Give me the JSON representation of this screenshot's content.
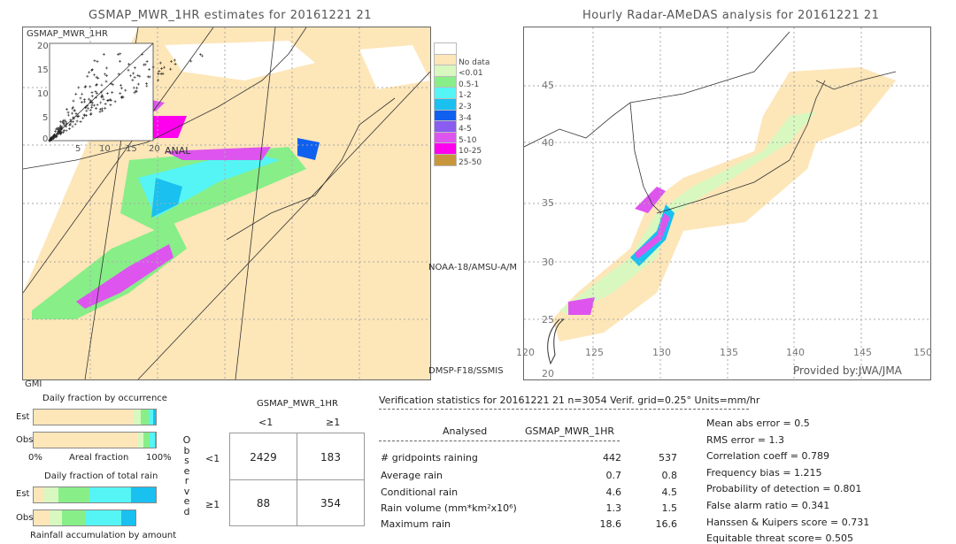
{
  "left_map": {
    "title": "GSMAP_MWR_1HR estimates for 20161221 21",
    "inset_label": "GSMAP_MWR_1HR",
    "inset_ticks": [
      "0",
      "5",
      "10",
      "15",
      "20"
    ],
    "anal_label": "ANAL",
    "swath_labels": [
      "NOAA-18/AMSU-A/M",
      "DMSP-F18/SSMIS",
      "GMI"
    ]
  },
  "legend": {
    "items": [
      {
        "label": "",
        "color": "#ffffff"
      },
      {
        "label": "No data",
        "color": "#fde6b8"
      },
      {
        "label": "<0.01",
        "color": "#d8f8c0"
      },
      {
        "label": "0.5-1",
        "color": "#88ee88"
      },
      {
        "label": "1-2",
        "color": "#55f5f5"
      },
      {
        "label": "2-3",
        "color": "#19c0f0"
      },
      {
        "label": "3-4",
        "color": "#1060f0"
      },
      {
        "label": "4-5",
        "color": "#8a5cf0"
      },
      {
        "label": "5-10",
        "color": "#dd55ee"
      },
      {
        "label": "10-25",
        "color": "#ff00ee"
      },
      {
        "label": "25-50",
        "color": "#c8963c"
      }
    ]
  },
  "right_map": {
    "title": "Hourly Radar-AMeDAS analysis for 20161221 21",
    "lon_ticks": [
      "120",
      "125",
      "130",
      "135",
      "140",
      "145",
      "150"
    ],
    "lat_ticks": [
      "45",
      "40",
      "35",
      "30",
      "25",
      "20"
    ],
    "credit": "Provided by:JWA/JMA"
  },
  "fraction": {
    "occ_title": "Daily fraction by occurrence",
    "est": "Est",
    "obs": "Obs",
    "x0": "0%",
    "xlabel": "Areal fraction",
    "x1": "100%",
    "rain_title": "Daily fraction of total rain",
    "accum_label": "Rainfall accumulation by amount",
    "occ_est": [
      0.82,
      0.06,
      0.06,
      0.04,
      0.02
    ],
    "occ_obs": [
      0.85,
      0.05,
      0.05,
      0.04,
      0.01
    ],
    "rain_est": [
      0.09,
      0.11,
      0.26,
      0.34,
      0.2
    ],
    "rain_obs": [
      0.13,
      0.1,
      0.2,
      0.29,
      0.11
    ]
  },
  "contingency": {
    "title": "GSMAP_MWR_1HR",
    "col_labels": [
      "<1",
      "≥1"
    ],
    "row_labels": [
      "<1",
      "≥1"
    ],
    "observed_label": "Observed",
    "cells": [
      [
        "2429",
        "183"
      ],
      [
        "88",
        "354"
      ]
    ]
  },
  "stats": {
    "header": "Verification statistics for 20161221 21  n=3054  Verif. grid=0.25°  Units=mm/hr",
    "col_analysed": "Analysed",
    "col_gsmap": "GSMAP_MWR_1HR",
    "rows": [
      {
        "label": "# gridpoints raining",
        "a": "442",
        "b": "537"
      },
      {
        "label": "Average rain",
        "a": "0.7",
        "b": "0.8"
      },
      {
        "label": "Conditional rain",
        "a": "4.6",
        "b": "4.5"
      },
      {
        "label": "Rain volume (mm*km²x10⁶)",
        "a": "1.3",
        "b": "1.5"
      },
      {
        "label": "Maximum rain",
        "a": "18.6",
        "b": "16.6"
      }
    ],
    "scores": [
      "Mean abs error = 0.5",
      "RMS error = 1.3",
      "Correlation coeff = 0.789",
      "Frequency bias = 1.215",
      "Probability of detection = 0.801",
      "False alarm ratio = 0.341",
      "Hanssen & Kuipers score = 0.731",
      "Equitable threat score= 0.505"
    ]
  }
}
